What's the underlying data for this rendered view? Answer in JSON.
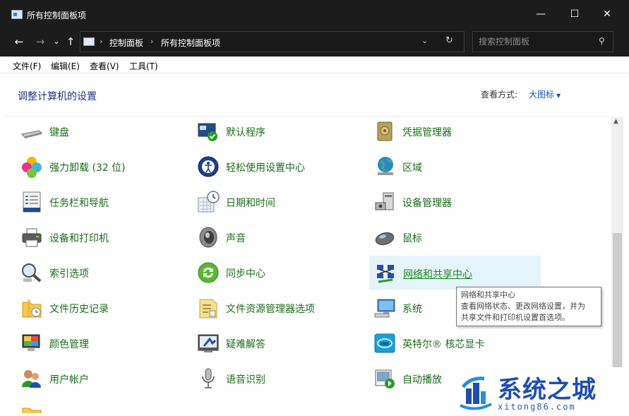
{
  "window": {
    "title": "所有控制面板项",
    "minimize": "—",
    "maximize": "☐",
    "close": "✕"
  },
  "nav": {
    "back": "←",
    "forward": "→",
    "recent": "⌄",
    "up": "↑",
    "breadcrumbs": [
      "控制面板",
      "所有控制面板项"
    ],
    "breadcrumb_sep": "›",
    "dropdown": "⌄",
    "refresh": "↻"
  },
  "search": {
    "placeholder": "搜索控制面板",
    "icon": "⚲"
  },
  "menubar": {
    "items": [
      "文件(F)",
      "编辑(E)",
      "查看(V)",
      "工具(T)"
    ]
  },
  "header": {
    "title": "调整计算机的设置",
    "view_label": "查看方式:",
    "view_value": "大图标",
    "view_caret": "▼"
  },
  "items": [
    {
      "label": "键盘",
      "icon": "keyboard-icon"
    },
    {
      "label": "默认程序",
      "icon": "default-programs-icon"
    },
    {
      "label": "凭据管理器",
      "icon": "credential-manager-icon"
    },
    {
      "label": "强力卸载 (32 位)",
      "icon": "uninstaller-icon"
    },
    {
      "label": "轻松使用设置中心",
      "icon": "ease-of-access-icon"
    },
    {
      "label": "区域",
      "icon": "region-globe-icon"
    },
    {
      "label": "任务栏和导航",
      "icon": "taskbar-icon"
    },
    {
      "label": "日期和时间",
      "icon": "calendar-clock-icon"
    },
    {
      "label": "设备管理器",
      "icon": "device-manager-icon"
    },
    {
      "label": "设备和打印机",
      "icon": "printer-icon"
    },
    {
      "label": "声音",
      "icon": "speaker-icon"
    },
    {
      "label": "鼠标",
      "icon": "mouse-icon"
    },
    {
      "label": "索引选项",
      "icon": "indexing-magnifier-icon"
    },
    {
      "label": "同步中心",
      "icon": "sync-icon"
    },
    {
      "label": "网络和共享中心",
      "icon": "network-icon"
    },
    {
      "label": "文件历史记录",
      "icon": "file-history-folder-icon"
    },
    {
      "label": "文件资源管理器选项",
      "icon": "folder-options-icon"
    },
    {
      "label": "系统",
      "icon": "system-computer-icon"
    },
    {
      "label": "颜色管理",
      "icon": "color-management-icon"
    },
    {
      "label": "疑难解答",
      "icon": "troubleshooting-icon"
    },
    {
      "label": "英特尔® 核芯显卡",
      "icon": "intel-graphics-icon"
    },
    {
      "label": "用户帐户",
      "icon": "user-accounts-icon"
    },
    {
      "label": "语音识别",
      "icon": "microphone-icon"
    },
    {
      "label": "自动播放",
      "icon": "autoplay-icon"
    }
  ],
  "tooltip": {
    "line1": "网络和共享中心",
    "line2": "查看网络状态、更改网络设置，并为",
    "line3": "共享文件和打印机设置首选项。"
  },
  "scrollbar": {
    "up_arrow": "▲"
  },
  "watermark": {
    "text": "系统之城",
    "url": "xitong86.com"
  },
  "colors": {
    "titlebar": "#1c1c1c",
    "link_green": "#1a6d1a",
    "title_blue": "#1e3287",
    "hover_bg": "#e5f3fb"
  }
}
